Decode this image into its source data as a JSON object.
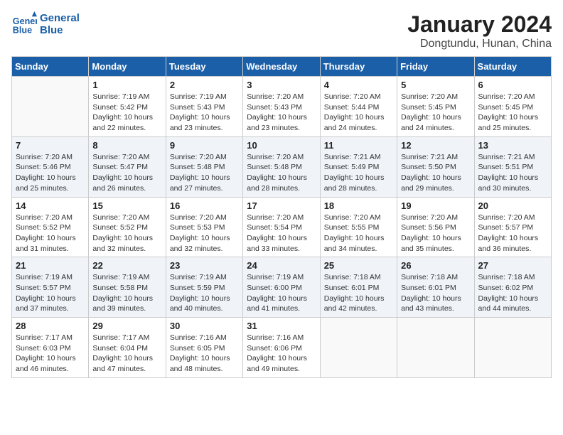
{
  "app": {
    "name_line1": "General",
    "name_line2": "Blue"
  },
  "title": "January 2024",
  "subtitle": "Dongtundu, Hunan, China",
  "weekdays": [
    "Sunday",
    "Monday",
    "Tuesday",
    "Wednesday",
    "Thursday",
    "Friday",
    "Saturday"
  ],
  "weeks": [
    [
      {
        "day": "",
        "info": ""
      },
      {
        "day": "1",
        "info": "Sunrise: 7:19 AM\nSunset: 5:42 PM\nDaylight: 10 hours\nand 22 minutes."
      },
      {
        "day": "2",
        "info": "Sunrise: 7:19 AM\nSunset: 5:43 PM\nDaylight: 10 hours\nand 23 minutes."
      },
      {
        "day": "3",
        "info": "Sunrise: 7:20 AM\nSunset: 5:43 PM\nDaylight: 10 hours\nand 23 minutes."
      },
      {
        "day": "4",
        "info": "Sunrise: 7:20 AM\nSunset: 5:44 PM\nDaylight: 10 hours\nand 24 minutes."
      },
      {
        "day": "5",
        "info": "Sunrise: 7:20 AM\nSunset: 5:45 PM\nDaylight: 10 hours\nand 24 minutes."
      },
      {
        "day": "6",
        "info": "Sunrise: 7:20 AM\nSunset: 5:45 PM\nDaylight: 10 hours\nand 25 minutes."
      }
    ],
    [
      {
        "day": "7",
        "info": "Sunrise: 7:20 AM\nSunset: 5:46 PM\nDaylight: 10 hours\nand 25 minutes."
      },
      {
        "day": "8",
        "info": "Sunrise: 7:20 AM\nSunset: 5:47 PM\nDaylight: 10 hours\nand 26 minutes."
      },
      {
        "day": "9",
        "info": "Sunrise: 7:20 AM\nSunset: 5:48 PM\nDaylight: 10 hours\nand 27 minutes."
      },
      {
        "day": "10",
        "info": "Sunrise: 7:20 AM\nSunset: 5:48 PM\nDaylight: 10 hours\nand 28 minutes."
      },
      {
        "day": "11",
        "info": "Sunrise: 7:21 AM\nSunset: 5:49 PM\nDaylight: 10 hours\nand 28 minutes."
      },
      {
        "day": "12",
        "info": "Sunrise: 7:21 AM\nSunset: 5:50 PM\nDaylight: 10 hours\nand 29 minutes."
      },
      {
        "day": "13",
        "info": "Sunrise: 7:21 AM\nSunset: 5:51 PM\nDaylight: 10 hours\nand 30 minutes."
      }
    ],
    [
      {
        "day": "14",
        "info": "Sunrise: 7:20 AM\nSunset: 5:52 PM\nDaylight: 10 hours\nand 31 minutes."
      },
      {
        "day": "15",
        "info": "Sunrise: 7:20 AM\nSunset: 5:52 PM\nDaylight: 10 hours\nand 32 minutes."
      },
      {
        "day": "16",
        "info": "Sunrise: 7:20 AM\nSunset: 5:53 PM\nDaylight: 10 hours\nand 32 minutes."
      },
      {
        "day": "17",
        "info": "Sunrise: 7:20 AM\nSunset: 5:54 PM\nDaylight: 10 hours\nand 33 minutes."
      },
      {
        "day": "18",
        "info": "Sunrise: 7:20 AM\nSunset: 5:55 PM\nDaylight: 10 hours\nand 34 minutes."
      },
      {
        "day": "19",
        "info": "Sunrise: 7:20 AM\nSunset: 5:56 PM\nDaylight: 10 hours\nand 35 minutes."
      },
      {
        "day": "20",
        "info": "Sunrise: 7:20 AM\nSunset: 5:57 PM\nDaylight: 10 hours\nand 36 minutes."
      }
    ],
    [
      {
        "day": "21",
        "info": "Sunrise: 7:19 AM\nSunset: 5:57 PM\nDaylight: 10 hours\nand 37 minutes."
      },
      {
        "day": "22",
        "info": "Sunrise: 7:19 AM\nSunset: 5:58 PM\nDaylight: 10 hours\nand 39 minutes."
      },
      {
        "day": "23",
        "info": "Sunrise: 7:19 AM\nSunset: 5:59 PM\nDaylight: 10 hours\nand 40 minutes."
      },
      {
        "day": "24",
        "info": "Sunrise: 7:19 AM\nSunset: 6:00 PM\nDaylight: 10 hours\nand 41 minutes."
      },
      {
        "day": "25",
        "info": "Sunrise: 7:18 AM\nSunset: 6:01 PM\nDaylight: 10 hours\nand 42 minutes."
      },
      {
        "day": "26",
        "info": "Sunrise: 7:18 AM\nSunset: 6:01 PM\nDaylight: 10 hours\nand 43 minutes."
      },
      {
        "day": "27",
        "info": "Sunrise: 7:18 AM\nSunset: 6:02 PM\nDaylight: 10 hours\nand 44 minutes."
      }
    ],
    [
      {
        "day": "28",
        "info": "Sunrise: 7:17 AM\nSunset: 6:03 PM\nDaylight: 10 hours\nand 46 minutes."
      },
      {
        "day": "29",
        "info": "Sunrise: 7:17 AM\nSunset: 6:04 PM\nDaylight: 10 hours\nand 47 minutes."
      },
      {
        "day": "30",
        "info": "Sunrise: 7:16 AM\nSunset: 6:05 PM\nDaylight: 10 hours\nand 48 minutes."
      },
      {
        "day": "31",
        "info": "Sunrise: 7:16 AM\nSunset: 6:06 PM\nDaylight: 10 hours\nand 49 minutes."
      },
      {
        "day": "",
        "info": ""
      },
      {
        "day": "",
        "info": ""
      },
      {
        "day": "",
        "info": ""
      }
    ]
  ]
}
